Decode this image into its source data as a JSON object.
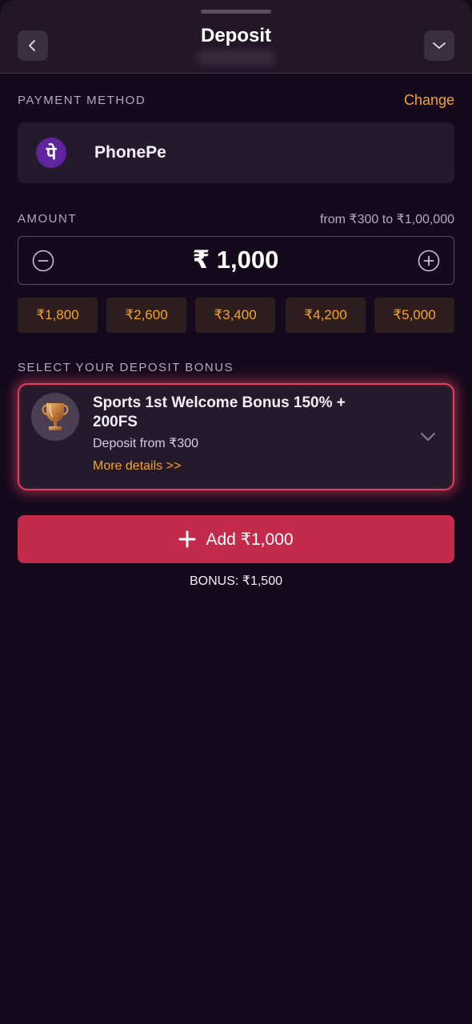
{
  "header": {
    "title": "Deposit"
  },
  "payment_method": {
    "label": "PAYMENT METHOD",
    "change_label": "Change",
    "method_name": "PhonePe",
    "logo_glyph": "पे",
    "logo_color": "#5f259f"
  },
  "amount": {
    "label": "AMOUNT",
    "range": "from ₹300 to ₹1,00,000",
    "value": "₹ 1,000",
    "presets": [
      "₹1,800",
      "₹2,600",
      "₹3,400",
      "₹4,200",
      "₹5,000"
    ]
  },
  "bonus": {
    "label": "SELECT YOUR DEPOSIT BONUS",
    "title": "Sports 1st Welcome Bonus 150% + 200FS",
    "subtitle": "Deposit from ₹300",
    "more_link": "More details >>",
    "icon": "trophy-icon"
  },
  "submit": {
    "label": "Add ₹1,000",
    "bonus_text": "BONUS: ₹1,500"
  },
  "colors": {
    "accent": "#f5a524",
    "primary": "#c42a4a",
    "background": "#150a1c"
  }
}
